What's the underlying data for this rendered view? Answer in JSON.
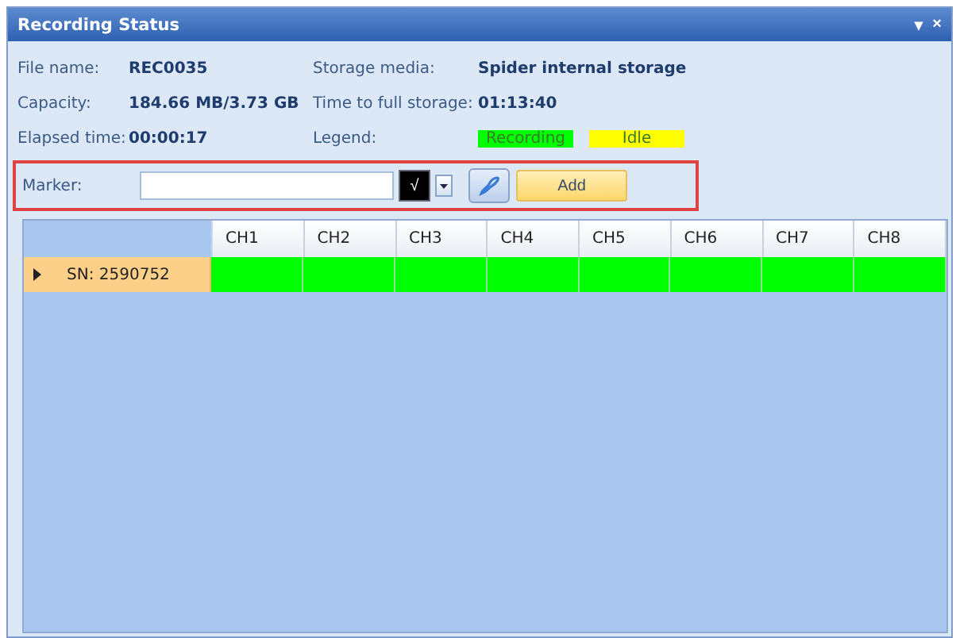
{
  "window": {
    "title": "Recording Status",
    "controls": [
      "▾",
      "×"
    ]
  },
  "info": [
    {
      "label": "File name:",
      "value": "REC0035"
    },
    {
      "label": "Storage media:",
      "value": "Spider internal storage"
    },
    {
      "label": "Capacity:",
      "value": "184.66 MB/3.73 GB"
    },
    {
      "label": "Time to full storage:",
      "value": "01:13:40"
    },
    {
      "label": "Elapsed time:",
      "value": "00:00:17"
    }
  ],
  "legend": {
    "label": "Legend:",
    "items": [
      {
        "label": "Recording",
        "color": "#00ff00"
      },
      {
        "label": "Idle",
        "color": "#ffff00"
      }
    ]
  },
  "marker": {
    "label": "Marker:",
    "check": "√",
    "add_button": "Add"
  },
  "grid": {
    "columns": [
      "CH1",
      "CH2",
      "CH3",
      "CH4",
      "CH5",
      "CH6",
      "CH7",
      "CH8"
    ],
    "rows": [
      {
        "label": "SN: 2590752",
        "expanded": false,
        "cells": [
          {
            "color": "#00ff00"
          },
          {
            "color": "#00ff00"
          },
          {
            "color": "#00ff00"
          },
          {
            "color": "#00ff00"
          },
          {
            "color": "#00ff00"
          },
          {
            "color": "#00ff00"
          },
          {
            "color": "#00ff00"
          },
          {
            "color": "#00ff00"
          }
        ]
      }
    ]
  }
}
